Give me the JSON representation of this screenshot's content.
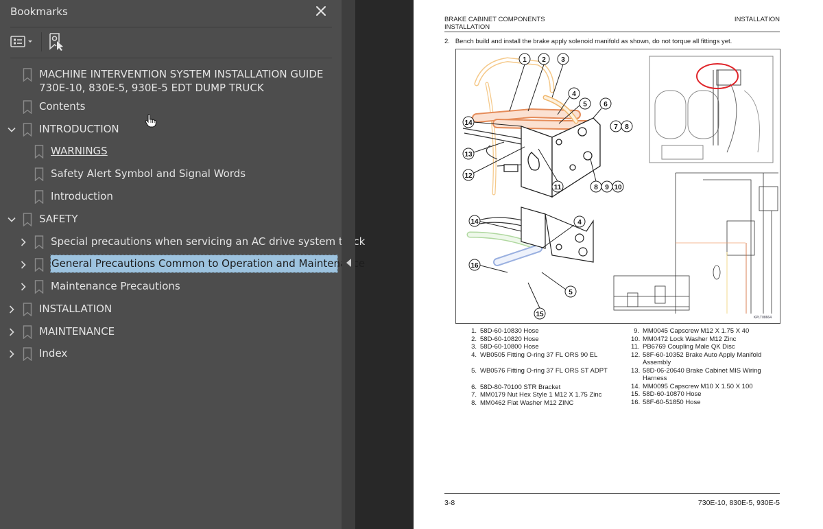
{
  "panel": {
    "title": "Bookmarks",
    "close_icon": "close-icon",
    "toolbar": {
      "options_icon": "list-options-icon",
      "find_icon": "find-current-bookmark-icon"
    },
    "bookmarks": [
      {
        "label": "MACHINE INTERVENTION SYSTEM INSTALLATION GUIDE",
        "label2": "730E-10, 830E-5, 930E-5 EDT DUMP TRUCK",
        "level": 0,
        "expander": "none"
      },
      {
        "label": "Contents",
        "level": 0,
        "expander": "none"
      },
      {
        "label": "INTRODUCTION",
        "level": 0,
        "expander": "expanded"
      },
      {
        "label": "WARNINGS",
        "level": 1,
        "expander": "none",
        "hovered": true
      },
      {
        "label": "Safety Alert Symbol and Signal Words",
        "level": 1,
        "expander": "none"
      },
      {
        "label": "Introduction",
        "level": 1,
        "expander": "none"
      },
      {
        "label": "SAFETY",
        "level": 0,
        "expander": "expanded"
      },
      {
        "label": "Special precautions when servicing an AC drive system truck",
        "level": 1,
        "expander": "collapsed"
      },
      {
        "label": "General Precautions Common to Operation and Maintenance",
        "level": 1,
        "expander": "collapsed",
        "selected": true
      },
      {
        "label": "Maintenance Precautions",
        "level": 1,
        "expander": "collapsed"
      },
      {
        "label": "INSTALLATION",
        "level": 0,
        "expander": "collapsed"
      },
      {
        "label": "MAINTENANCE",
        "level": 0,
        "expander": "collapsed"
      },
      {
        "label": "Index",
        "level": 0,
        "expander": "collapsed"
      }
    ],
    "selection_color": "#9dc3df"
  },
  "page": {
    "header_left_line1": "BRAKE CABINET COMPONENTS",
    "header_left_line2": "INSTALLATION",
    "header_right": "INSTALLATION",
    "step": "2.   Bench build and install the brake apply solenoid manifold as shown, do not torque all fittings yet.",
    "figure": {
      "callouts_top": [
        "1",
        "2",
        "3",
        "4",
        "5",
        "6",
        "7",
        "8",
        "14",
        "13",
        "12",
        "11",
        "8",
        "9",
        "10"
      ],
      "callouts_bottom": [
        "14",
        "4",
        "16",
        "5",
        "15"
      ],
      "figure_code": "KPLT08664",
      "highlight_color": "#e0262b"
    },
    "parts_left": [
      {
        "n": "1.",
        "t": "58D-60-10830 Hose"
      },
      {
        "n": "2.",
        "t": "58D-60-10820 Hose"
      },
      {
        "n": "3.",
        "t": "58D-60-10800 Hose"
      },
      {
        "n": "4.",
        "t": "WB0505 Fitting O-ring 37 FL ORS 90 EL"
      },
      {
        "n": "5.",
        "t": "WB0576 Fitting O-ring 37 FL ORS ST ADPT"
      },
      {
        "n": "6.",
        "t": "58D-80-70100 STR Bracket"
      },
      {
        "n": "7.",
        "t": "MM0179 Nut Hex Style 1 M12 X 1.75 Zinc"
      },
      {
        "n": "8.",
        "t": "MM0462 Flat Washer M12 ZINC"
      }
    ],
    "parts_right": [
      {
        "n": "9.",
        "t": "MM0045 Capscrew M12 X 1.75 X 40"
      },
      {
        "n": "10.",
        "t": "MM0472 Lock Washer M12 Zinc"
      },
      {
        "n": "11.",
        "t": "PB6769 Coupling Male QK Disc"
      },
      {
        "n": "12.",
        "t": "58F-60-10352 Brake Auto Apply Manifold Assembly"
      },
      {
        "n": "13.",
        "t": "58D-06-20640 Brake Cabinet MIS Wiring Harness"
      },
      {
        "n": "14.",
        "t": "MM0095 Capscrew M10 X 1.50 X 100"
      },
      {
        "n": "15.",
        "t": "58D-60-10870 Hose"
      },
      {
        "n": "16.",
        "t": "58F-60-51850 Hose"
      }
    ],
    "footer_left": "3-8",
    "footer_right": "730E-10, 830E-5, 930E-5"
  }
}
